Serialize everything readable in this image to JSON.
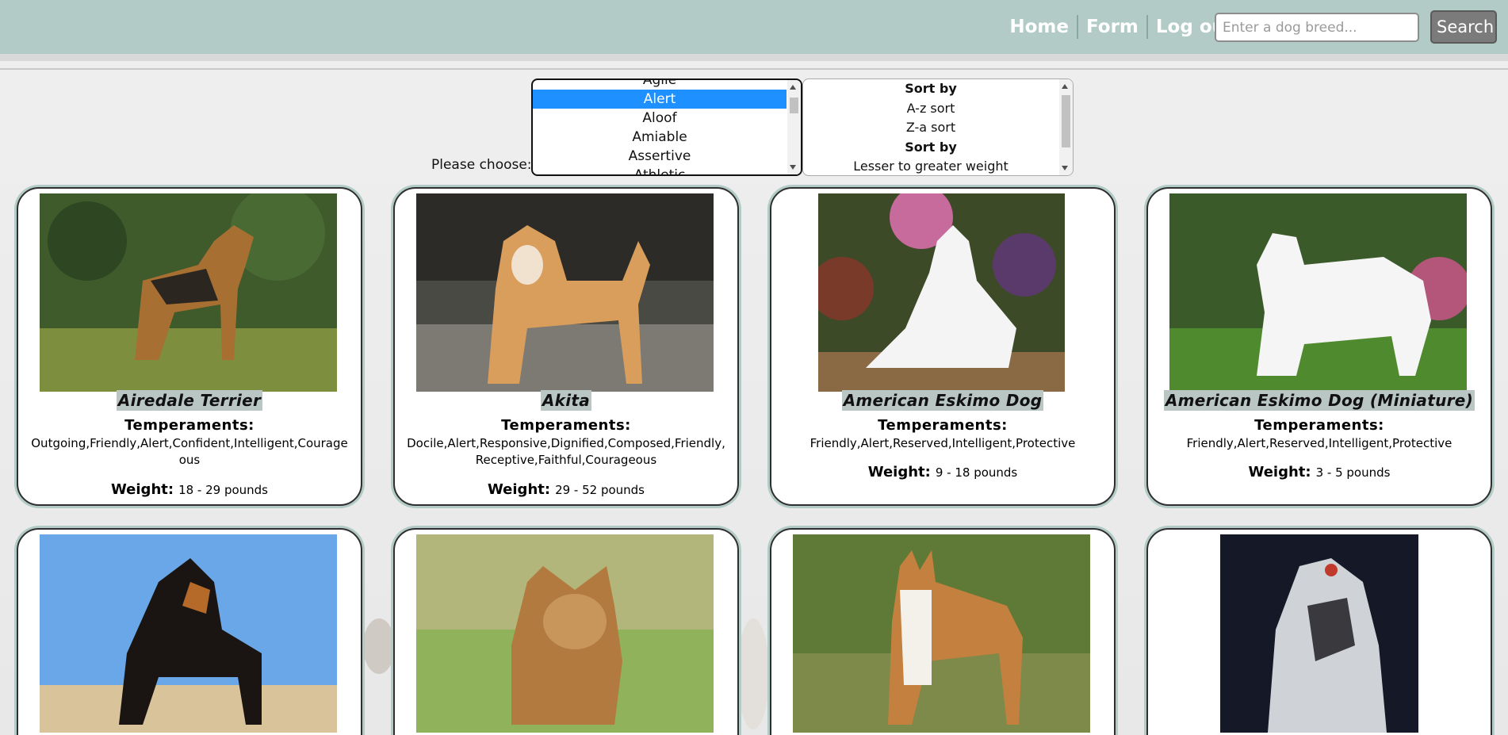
{
  "header": {
    "nav": [
      {
        "label": "Home"
      },
      {
        "label": "Form"
      },
      {
        "label": "Log out"
      }
    ],
    "search": {
      "placeholder": "Enter a dog breed...",
      "button_label": "Search"
    }
  },
  "filters": {
    "choose_label": "Please choose:",
    "temperaments": {
      "items": [
        "Agile",
        "Alert",
        "Aloof",
        "Amiable",
        "Assertive",
        "Athletic"
      ],
      "selected": "Alert"
    },
    "sort": {
      "items": [
        {
          "label": "Sort by",
          "group": true
        },
        {
          "label": "A-z sort",
          "group": false
        },
        {
          "label": "Z-a sort",
          "group": false
        },
        {
          "label": "Sort by",
          "group": true
        },
        {
          "label": "Lesser to greater weight",
          "group": false
        }
      ]
    }
  },
  "cards": [
    {
      "name": "Airedale Terrier",
      "temperaments_title": "Temperaments:",
      "temperaments": "Outgoing,Friendly,Alert,Confident,Intelligent,Courageous",
      "weight_label": "Weight:",
      "weight": "18 - 29 pounds"
    },
    {
      "name": "Akita",
      "temperaments_title": "Temperaments:",
      "temperaments": "Docile,Alert,Responsive,Dignified,Composed,Friendly,Receptive,Faithful,Courageous",
      "weight_label": "Weight:",
      "weight": "29 - 52 pounds"
    },
    {
      "name": "American Eskimo Dog",
      "temperaments_title": "Temperaments:",
      "temperaments": "Friendly,Alert,Reserved,Intelligent,Protective",
      "weight_label": "Weight:",
      "weight": "9 - 18 pounds"
    },
    {
      "name": "American Eskimo Dog (Miniature)",
      "temperaments_title": "Temperaments:",
      "temperaments": "Friendly,Alert,Reserved,Intelligent,Protective",
      "weight_label": "Weight:",
      "weight": "3 - 5 pounds"
    }
  ],
  "colors": {
    "header": "#b2cbc6",
    "card_border": "#2f2f2f",
    "name_highlight": "#b9c6c4",
    "selected_option": "#1e90ff"
  }
}
